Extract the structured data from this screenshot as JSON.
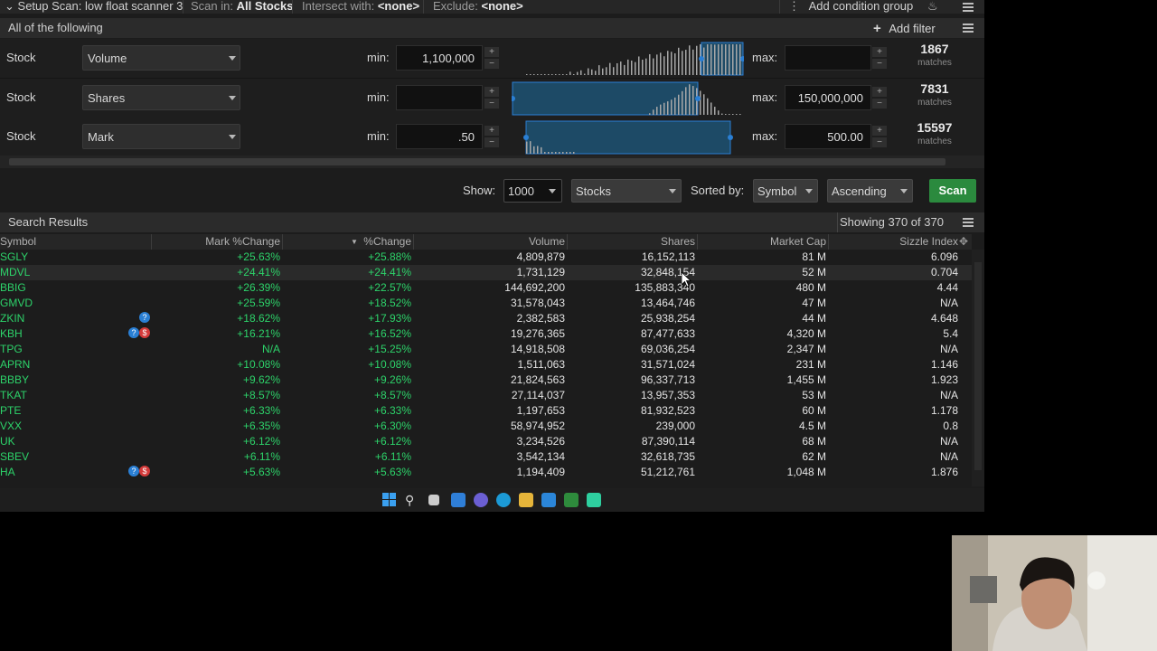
{
  "topbar": {
    "setup_label": "Setup Scan: low float scanner 3",
    "scan_in_label": "Scan in:",
    "scan_in_value": "All Stocks",
    "intersect_label": "Intersect with:",
    "intersect_value": "<none>",
    "exclude_label": "Exclude:",
    "exclude_value": "<none>",
    "add_group": "Add condition group"
  },
  "filters_header": {
    "label": "All of the following",
    "add_filter": "Add filter"
  },
  "filters": [
    {
      "type": "Stock",
      "field": "Volume",
      "min_label": "min:",
      "min": "1,100,000",
      "max_label": "max:",
      "max": "",
      "matches": "1867",
      "matches_label": "matches"
    },
    {
      "type": "Stock",
      "field": "Shares",
      "min_label": "min:",
      "min": "",
      "max_label": "max:",
      "max": "150,000,000",
      "matches": "7831",
      "matches_label": "matches"
    },
    {
      "type": "Stock",
      "field": "Mark",
      "min_label": "min:",
      "min": ".50",
      "max_label": "max:",
      "max": "500.00",
      "matches": "15597",
      "matches_label": "matches"
    }
  ],
  "controls": {
    "show_label": "Show:",
    "show_value": "1000",
    "type_value": "Stocks",
    "sorted_label": "Sorted by:",
    "sorted_value": "Symbol",
    "order_value": "Ascending",
    "scan_button": "Scan"
  },
  "results": {
    "title": "Search Results",
    "count": "Showing 370 of 370",
    "columns": [
      "Symbol",
      "Mark %Change",
      "%Change",
      "Volume",
      "Shares",
      "Market Cap",
      "Sizzle Index"
    ],
    "rows": [
      {
        "symbol": "SGLY",
        "mark_change": "+25.63%",
        "change": "+25.88%",
        "volume": "4,809,879",
        "shares": "16,152,113",
        "cap": "81 M",
        "sizzle": "6.096",
        "badges": []
      },
      {
        "symbol": "MDVL",
        "mark_change": "+24.41%",
        "change": "+24.41%",
        "volume": "1,731,129",
        "shares": "32,848,154",
        "cap": "52 M",
        "sizzle": "0.704",
        "badges": []
      },
      {
        "symbol": "BBIG",
        "mark_change": "+26.39%",
        "change": "+22.57%",
        "volume": "144,692,200",
        "shares": "135,883,340",
        "cap": "480 M",
        "sizzle": "4.44",
        "badges": []
      },
      {
        "symbol": "GMVD",
        "mark_change": "+25.59%",
        "change": "+18.52%",
        "volume": "31,578,043",
        "shares": "13,464,746",
        "cap": "47 M",
        "sizzle": "N/A",
        "badges": []
      },
      {
        "symbol": "ZKIN",
        "mark_change": "+18.62%",
        "change": "+17.93%",
        "volume": "2,382,583",
        "shares": "25,938,254",
        "cap": "44 M",
        "sizzle": "4.648",
        "badges": [
          "blue"
        ]
      },
      {
        "symbol": "KBH",
        "mark_change": "+16.21%",
        "change": "+16.52%",
        "volume": "19,276,365",
        "shares": "87,477,633",
        "cap": "4,320 M",
        "sizzle": "5.4",
        "badges": [
          "blue",
          "red"
        ]
      },
      {
        "symbol": "TPG",
        "mark_change": "N/A",
        "change": "+15.25%",
        "volume": "14,918,508",
        "shares": "69,036,254",
        "cap": "2,347 M",
        "sizzle": "N/A",
        "badges": []
      },
      {
        "symbol": "APRN",
        "mark_change": "+10.08%",
        "change": "+10.08%",
        "volume": "1,511,063",
        "shares": "31,571,024",
        "cap": "231 M",
        "sizzle": "1.146",
        "badges": []
      },
      {
        "symbol": "BBBY",
        "mark_change": "+9.62%",
        "change": "+9.26%",
        "volume": "21,824,563",
        "shares": "96,337,713",
        "cap": "1,455 M",
        "sizzle": "1.923",
        "badges": []
      },
      {
        "symbol": "TKAT",
        "mark_change": "+8.57%",
        "change": "+8.57%",
        "volume": "27,114,037",
        "shares": "13,957,353",
        "cap": "53 M",
        "sizzle": "N/A",
        "badges": []
      },
      {
        "symbol": "PTE",
        "mark_change": "+6.33%",
        "change": "+6.33%",
        "volume": "1,197,653",
        "shares": "81,932,523",
        "cap": "60 M",
        "sizzle": "1.178",
        "badges": []
      },
      {
        "symbol": "VXX",
        "mark_change": "+6.35%",
        "change": "+6.30%",
        "volume": "58,974,952",
        "shares": "239,000",
        "cap": "4.5 M",
        "sizzle": "0.8",
        "badges": []
      },
      {
        "symbol": "UK",
        "mark_change": "+6.12%",
        "change": "+6.12%",
        "volume": "3,234,526",
        "shares": "87,390,114",
        "cap": "68 M",
        "sizzle": "N/A",
        "badges": []
      },
      {
        "symbol": "SBEV",
        "mark_change": "+6.11%",
        "change": "+6.11%",
        "volume": "3,542,134",
        "shares": "32,618,735",
        "cap": "62 M",
        "sizzle": "N/A",
        "badges": []
      },
      {
        "symbol": "HA",
        "mark_change": "+5.63%",
        "change": "+5.63%",
        "volume": "1,194,409",
        "shares": "51,212,761",
        "cap": "1,048 M",
        "sizzle": "1.876",
        "badges": [
          "blue",
          "red"
        ]
      }
    ]
  },
  "colors": {
    "positive": "#2dd36a",
    "accent_blue": "#2a7fd4",
    "scan_green": "#2b8a3e"
  }
}
